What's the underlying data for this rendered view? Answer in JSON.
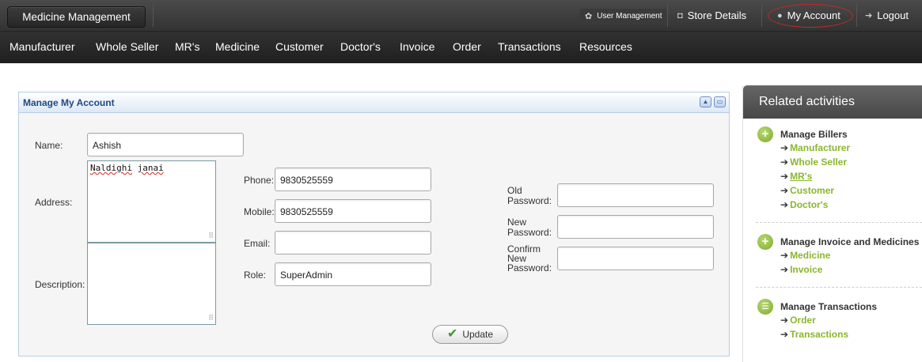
{
  "topbar": {
    "brand": "Medicine Management",
    "user_management": "User Management",
    "store_details": "Store Details",
    "my_account": "My Account",
    "logout": "Logout"
  },
  "nav": {
    "items": [
      "Manufacturer",
      "Whole Seller",
      "MR's",
      "Medicine",
      "Customer",
      "Doctor's",
      "Invoice",
      "Order",
      "Transactions",
      "Resources"
    ]
  },
  "panel": {
    "title": "Manage My Account",
    "labels": {
      "name": "Name:",
      "address": "Address:",
      "description": "Description:",
      "phone": "Phone:",
      "mobile": "Mobile:",
      "email": "Email:",
      "role": "Role:",
      "old_password_1": "Old",
      "old_password_2": "Password:",
      "new_password_1": "New",
      "new_password_2": "Password:",
      "confirm_password_1": "Confirm",
      "confirm_password_2": "New",
      "confirm_password_3": "Password:"
    },
    "values": {
      "name": "Ashish",
      "address_line1": "Naldighi",
      "address_line2": "janai",
      "description": "",
      "phone": "9830525559",
      "mobile": "9830525559",
      "email": "",
      "role": "SuperAdmin",
      "old_password": "",
      "new_password": "",
      "confirm_password": ""
    },
    "update_label": "Update"
  },
  "sidebar": {
    "title": "Related activities",
    "groups": [
      {
        "title": "Manage Billers",
        "icon": "plus-icon",
        "links": [
          "Manufacturer",
          "Whole Seller",
          "MR's",
          "Customer",
          "Doctor's"
        ]
      },
      {
        "title": "Manage Invoice and Medicines",
        "icon": "plus-icon",
        "links": [
          "Medicine",
          "Invoice"
        ]
      },
      {
        "title": "Manage Transactions",
        "icon": "list-icon",
        "links": [
          "Order",
          "Transactions"
        ]
      }
    ]
  },
  "colors": {
    "accent_green": "#8ab62e",
    "panel_title": "#1e4a82",
    "highlight_ring": "#c62828"
  }
}
